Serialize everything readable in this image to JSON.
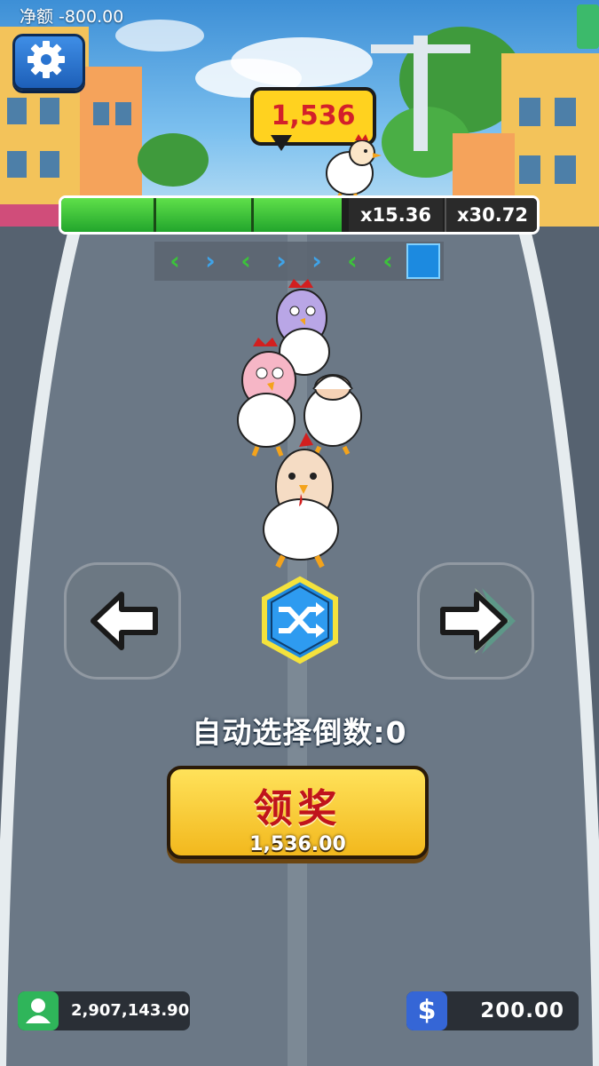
{
  "header": {
    "net_label": "净额",
    "net_value": "-800.00"
  },
  "icons": {
    "settings": "gear-icon",
    "user": "user-icon",
    "currency": "dollar-icon",
    "shuffle": "shuffle-icon",
    "left": "left-arrow-icon",
    "right": "right-arrow-icon"
  },
  "bubble": {
    "value": "1,536"
  },
  "progress": {
    "fill_fraction": 0.59,
    "segments": 3,
    "multipliers": [
      "x15.36",
      "x30.72"
    ]
  },
  "direction_strip": [
    {
      "dir": "left"
    },
    {
      "dir": "right"
    },
    {
      "dir": "left"
    },
    {
      "dir": "right"
    },
    {
      "dir": "right"
    },
    {
      "dir": "left"
    },
    {
      "dir": "left"
    },
    {
      "dir": "current"
    }
  ],
  "countdown": {
    "text": "自动选择倒数:0"
  },
  "claim": {
    "label": "领奖",
    "amount": "1,536.00"
  },
  "balance": {
    "value": "2,907,143.90"
  },
  "bet": {
    "symbol": "$",
    "value": "200.00"
  },
  "colors": {
    "progress_green": "#3cc33a",
    "claim_yellow": "#f7c52b",
    "claim_text": "#c0141c",
    "bubble_yellow": "#ffd21f",
    "strip_left": "#3cc33a",
    "strip_right": "#3fa3e8",
    "strip_current": "#1c8ae0"
  }
}
